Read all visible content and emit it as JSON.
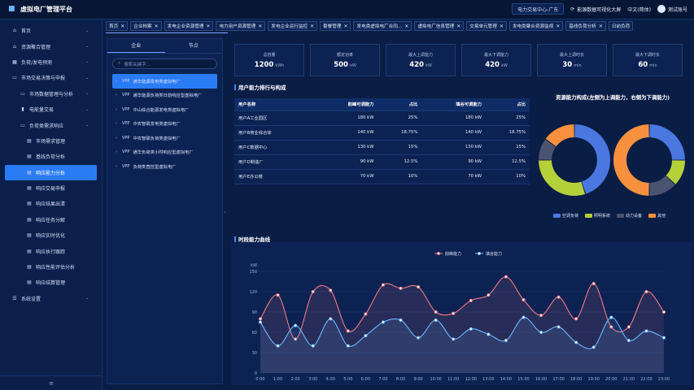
{
  "app": {
    "title": "虚拟电厂管理平台"
  },
  "topbar": {
    "center": "电力交易中心-广东",
    "sync": "能源数据可视化大屏",
    "lang": "中文(简体)",
    "user": "测试账号"
  },
  "sidebar": {
    "items": [
      {
        "label": "首页",
        "level": 1,
        "icon": "home",
        "arrow": true
      },
      {
        "label": "资源聚合管理",
        "level": 1,
        "icon": "home",
        "arrow": true
      },
      {
        "label": "负荷/发电预测",
        "level": 1,
        "icon": "chart",
        "arrow": true
      },
      {
        "label": "市场交易决策与申报",
        "level": 1,
        "icon": "monitor",
        "arrow": true
      },
      {
        "label": "市场数据管理与分析",
        "level": 2,
        "icon": "monitor",
        "arrow": true
      },
      {
        "label": "电能量交易",
        "level": 2,
        "icon": "bars",
        "arrow": true
      },
      {
        "label": "负荷类需求响应",
        "level": 2,
        "icon": "monitor",
        "arrow": true
      },
      {
        "label": "市场需求管理",
        "level": 3,
        "icon": "doc",
        "arrow": false
      },
      {
        "label": "基线负荷分析",
        "level": 3,
        "icon": "doc",
        "arrow": false
      },
      {
        "label": "响应能力分析",
        "level": 3,
        "icon": "doc",
        "arrow": false,
        "active": true
      },
      {
        "label": "响应交易申报",
        "level": 3,
        "icon": "doc",
        "arrow": false
      },
      {
        "label": "响应结果出清",
        "level": 3,
        "icon": "doc",
        "arrow": false
      },
      {
        "label": "响应任务分解",
        "level": 3,
        "icon": "doc",
        "arrow": false
      },
      {
        "label": "响应实时优化",
        "level": 3,
        "icon": "doc",
        "arrow": false
      },
      {
        "label": "响应执行跟踪",
        "level": 3,
        "icon": "doc",
        "arrow": false
      },
      {
        "label": "响应性能评估分析",
        "level": 3,
        "icon": "doc",
        "arrow": false
      },
      {
        "label": "响应结算管理",
        "level": 3,
        "icon": "doc",
        "arrow": false
      },
      {
        "label": "系统设置",
        "level": 1,
        "icon": "sliders",
        "arrow": true
      }
    ],
    "collapse": "≡"
  },
  "tabs": [
    "首页",
    "企业档案",
    "发电企业资源管理",
    "电力用户资源管理",
    "发电企业运行监控",
    "套餐管理",
    "发电类虚拟电厂合同…",
    "虚拟电厂信息管理",
    "交易单元管理",
    "发电类聚合资源监视",
    "基线负荷分析",
    "日前负荷"
  ],
  "tree": {
    "tabs": [
      "企业",
      "节点"
    ],
    "search_placeholder": "搜索关键字...",
    "items": [
      {
        "label": "通华能源发电类虚拟电厂",
        "selected": true
      },
      {
        "label": "通华能源负荷类日前响应型虚拟电厂"
      },
      {
        "label": "中山综合能源发电类虚拟电厂"
      },
      {
        "label": "中农智联发电类虚拟电厂"
      },
      {
        "label": "中农智联负荷类虚拟电厂"
      },
      {
        "label": "通华负荷类小时响应型虚拟电厂"
      },
      {
        "label": "负荷类直控型虚拟电厂"
      }
    ]
  },
  "kpis": [
    {
      "label": "总容量",
      "value": "1200",
      "unit": "kWh"
    },
    {
      "label": "额定功率",
      "value": "500",
      "unit": "kW"
    },
    {
      "label": "最大上调能力",
      "value": "420",
      "unit": "kW"
    },
    {
      "label": "最大下调能力",
      "value": "420",
      "unit": "kW"
    },
    {
      "label": "最大上调时长",
      "value": "30",
      "unit": "min"
    },
    {
      "label": "最大下调时长",
      "value": "60",
      "min": "",
      "unit": "min"
    }
  ],
  "ranking": {
    "title": "用户能力排行与构成",
    "headers": [
      "用户名称",
      "削峰可调能力",
      "占比",
      "填谷可调能力",
      "占比"
    ],
    "rows": [
      [
        "用户A工业园区",
        "180 kW",
        "25%",
        "180 kW",
        "25%"
      ],
      [
        "用户B商业综合体",
        "140 kW",
        "18.75%",
        "140 kW",
        "18.75%"
      ],
      [
        "用户C数据中心",
        "130 kW",
        "15%",
        "130 kW",
        "15%"
      ],
      [
        "用户D制造厂",
        "90 kW",
        "12.5%",
        "90 kW",
        "12.5%"
      ],
      [
        "用户E办公楼",
        "70 kW",
        "10%",
        "70 kW",
        "10%"
      ]
    ]
  },
  "composition": {
    "title": "资源能力构成(左侧为上调能力，右侧为下调能力)",
    "legend": [
      "空调负荷",
      "照明系统",
      "动力设备",
      "其他"
    ],
    "colors": [
      "#4a78e0",
      "#b4d13a",
      "#4a5470",
      "#f7913d"
    ],
    "left": [
      45,
      30,
      10,
      15
    ],
    "right": [
      25,
      12,
      13,
      50
    ]
  },
  "curve": {
    "title": "时段能力曲线",
    "chart_data": {
      "type": "line",
      "ylabel": "kW",
      "ylim": [
        0,
        150
      ],
      "yticks": [
        "0",
        "30",
        "60",
        "90",
        "120",
        "150"
      ],
      "categories": [
        "0:00",
        "1:00",
        "2:00",
        "3:00",
        "4:00",
        "5:00",
        "6:00",
        "7:00",
        "8:00",
        "9:00",
        "10:00",
        "11:00",
        "12:00",
        "13:00",
        "14:00",
        "15:00",
        "16:00",
        "17:00",
        "18:00",
        "19:00",
        "20:00",
        "21:00",
        "22:00",
        "23:00"
      ],
      "series": [
        {
          "name": "削峰能力",
          "color": "#f07a86",
          "values": [
            80,
            115,
            50,
            120,
            122,
            62,
            87,
            130,
            125,
            127,
            90,
            88,
            107,
            115,
            142,
            108,
            85,
            112,
            80,
            132,
            68,
            68,
            120,
            90
          ]
        },
        {
          "name": "填谷能力",
          "color": "#6fb7ff",
          "values": [
            75,
            40,
            70,
            40,
            80,
            40,
            55,
            75,
            78,
            52,
            78,
            50,
            65,
            57,
            48,
            82,
            60,
            68,
            45,
            38,
            82,
            48,
            62,
            52
          ]
        }
      ]
    }
  }
}
